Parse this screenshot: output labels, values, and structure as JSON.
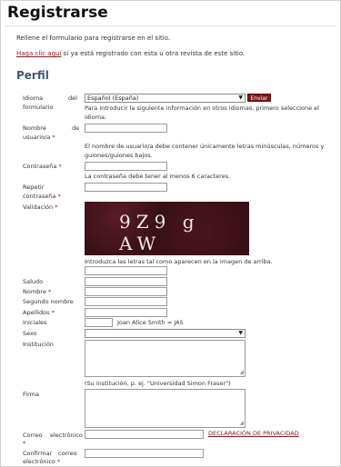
{
  "page": {
    "title": "Registrarse",
    "intro": "Rellene el formulario para registrarse en el sitio.",
    "login_link": "Haga clic aquí",
    "login_rest": " si ya está registrado con esta u otra revista de este sitio.",
    "section_title": "Perfil"
  },
  "form": {
    "language": {
      "label_1": "Idioma",
      "label_2": "del",
      "label_3": "formulario",
      "selected": "Español (España)",
      "submit_label": "Enviar",
      "help": "Para introducir la siguiente información en otros idiomas, primero seleccione el idioma."
    },
    "username": {
      "label_1": "Nombre",
      "label_2": "de",
      "label_3": "usuario/a",
      "required": "*",
      "help": "El nombre de usuario/a debe contener únicamente letras minúsculas, números y guiones/guiones bajos."
    },
    "password": {
      "label": "Contraseña",
      "required": "*",
      "help": "La contraseña debe tener al menos 6 caracteres."
    },
    "repeat_password": {
      "label_1": "Repetir",
      "label_2": "contraseña",
      "required": "*"
    },
    "captcha": {
      "label": "Validación",
      "required": "*",
      "image_text": "9Z9 g AW",
      "help": "Introduzca las letras tal como aparecen en la imagen de arriba."
    },
    "salutation": {
      "label": "Saludo"
    },
    "first_name": {
      "label": "Nombre",
      "required": "*"
    },
    "middle_name": {
      "label": "Segundo nombre"
    },
    "last_name": {
      "label": "Apellidos",
      "required": "*"
    },
    "initials": {
      "label": "Iniciales",
      "help": "Joan Alice Smith = JAS"
    },
    "gender": {
      "label": "Sexo"
    },
    "affiliation": {
      "label": "Institución",
      "help": "(Su institución, p. ej. \"Universidad Simon Fraser\")"
    },
    "signature": {
      "label": "Firma"
    },
    "email": {
      "label_1": "Correo",
      "label_2": "electrónico",
      "required": "*",
      "privacy_link": "DECLARACIÓN DE PRIVACIDAD"
    },
    "confirm_email": {
      "label_1": "Confirmar",
      "label_2": "correo",
      "label_3": "electrónico",
      "required": "*"
    }
  },
  "icons": {
    "dropdown_arrow": "▼",
    "resize_grip": "◢"
  },
  "colors": {
    "link": "#8b1a1a",
    "section_title": "#3c5a78",
    "button": "#7a1a1a"
  }
}
